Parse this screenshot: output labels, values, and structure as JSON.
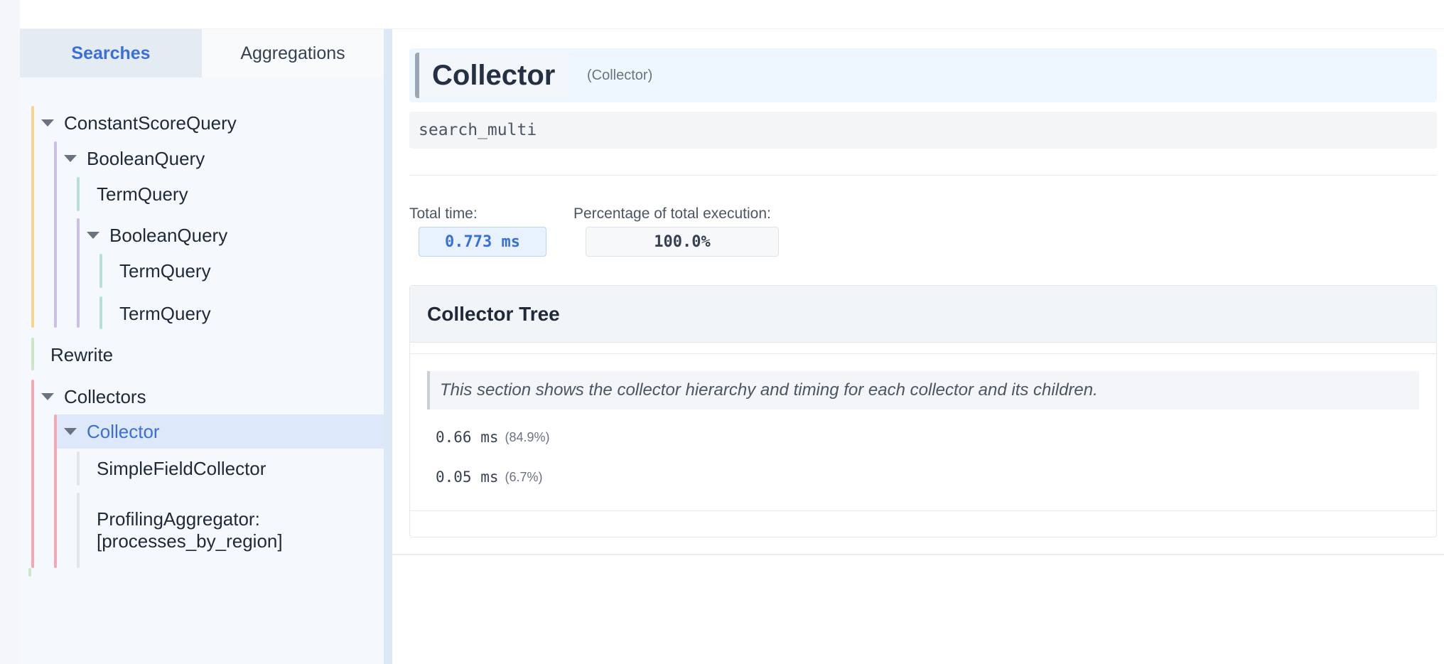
{
  "sidebar": {
    "tabs": [
      {
        "label": "Searches",
        "active": true
      },
      {
        "label": "Aggregations",
        "active": false
      }
    ],
    "tree": [
      {
        "label": "ConstantScoreQuery",
        "expandable": true
      },
      {
        "label": "BooleanQuery",
        "expandable": true
      },
      {
        "label": "TermQuery",
        "expandable": false
      },
      {
        "label": "BooleanQuery",
        "expandable": true
      },
      {
        "label": "TermQuery",
        "expandable": false
      },
      {
        "label": "TermQuery",
        "expandable": false
      },
      {
        "label": "Rewrite",
        "expandable": false
      },
      {
        "label": "Collectors",
        "expandable": true
      },
      {
        "label": "Collector",
        "expandable": true,
        "selected": true
      },
      {
        "label": "SimpleFieldCollector",
        "expandable": false
      },
      {
        "label": "ProfilingAggregator:\n[processes_by_region]",
        "expandable": false
      }
    ]
  },
  "main": {
    "title": "Collector",
    "subtitle": "(Collector)",
    "reason": "search_multi",
    "stats": {
      "total_time_label": "Total time:",
      "total_time_value": "0.773 ms",
      "percentage_label": "Percentage of total execution:",
      "percentage_value": "100.0%"
    },
    "collector_tree": {
      "heading": "Collector Tree",
      "note": "This section shows the collector hierarchy and timing for each collector and its children.",
      "rows": [
        {
          "time": "0.66 ms",
          "pct": "(84.9%)"
        },
        {
          "time": "0.05 ms",
          "pct": "(6.7%)"
        }
      ]
    }
  },
  "colors": {
    "accent": "#3b6fd8",
    "selected_bg": "#dde9fb",
    "tree_guide_orange": "#f6d58f",
    "tree_guide_purple": "#cbbfe4",
    "tree_guide_teal": "#b8e0d6",
    "tree_guide_green": "#cde6c8",
    "tree_guide_red": "#f2a9b4"
  }
}
